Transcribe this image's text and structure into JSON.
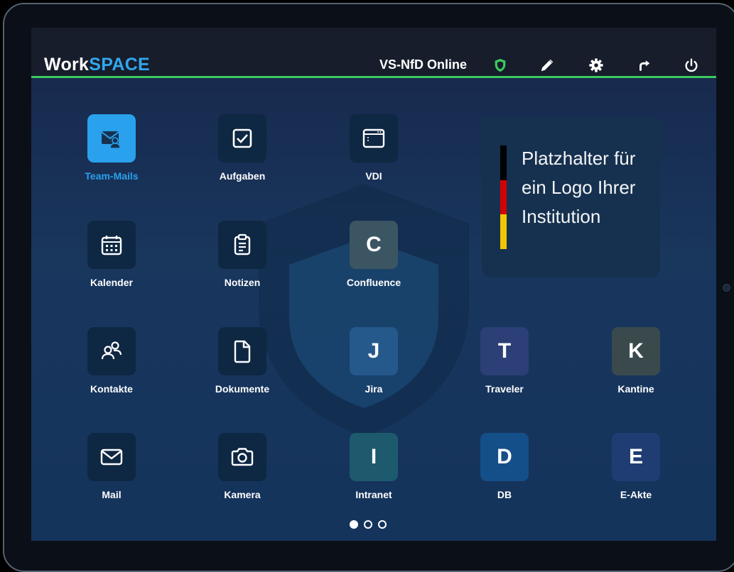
{
  "header": {
    "brand_part1": "Work",
    "brand_part2": "SPACE",
    "status": "VS-NfD Online",
    "icons": [
      "shield-check-icon",
      "pencil-icon",
      "gear-icon",
      "redirect-icon",
      "power-icon"
    ]
  },
  "colors": {
    "accent": "#32a7ee",
    "status_green": "#3ec95e",
    "topbar": "#171d2b"
  },
  "apps": [
    {
      "label": "Team-Mails",
      "icon": "team-mail-icon",
      "active": true
    },
    {
      "label": "Aufgaben",
      "icon": "checkbox-icon"
    },
    {
      "label": "VDI",
      "icon": "window-icon"
    },
    {
      "label": "Kalender",
      "icon": "calendar-icon"
    },
    {
      "label": "Notizen",
      "icon": "clipboard-icon"
    },
    {
      "label": "Confluence",
      "letter": "C"
    },
    {
      "label": "Kontakte",
      "icon": "contacts-icon"
    },
    {
      "label": "Dokumente",
      "icon": "document-icon"
    },
    {
      "label": "Jira",
      "letter": "J"
    },
    {
      "label": "Traveler",
      "letter": "T"
    },
    {
      "label": "Kantine",
      "letter": "K"
    },
    {
      "label": "Mail",
      "icon": "envelope-icon"
    },
    {
      "label": "Kamera",
      "icon": "camera-icon"
    },
    {
      "label": "Intranet",
      "letter": "I"
    },
    {
      "label": "DB",
      "letter": "D"
    },
    {
      "label": "E-Akte",
      "letter": "E"
    }
  ],
  "logo_placeholder": {
    "text_line1": "Platzhalter für",
    "text_line2": "ein Logo Ihrer",
    "text_line3": "Institution",
    "flag_colors": [
      "#000000",
      "#dd0000",
      "#ffce00"
    ]
  },
  "pagination": {
    "current": 1,
    "total": 3
  }
}
